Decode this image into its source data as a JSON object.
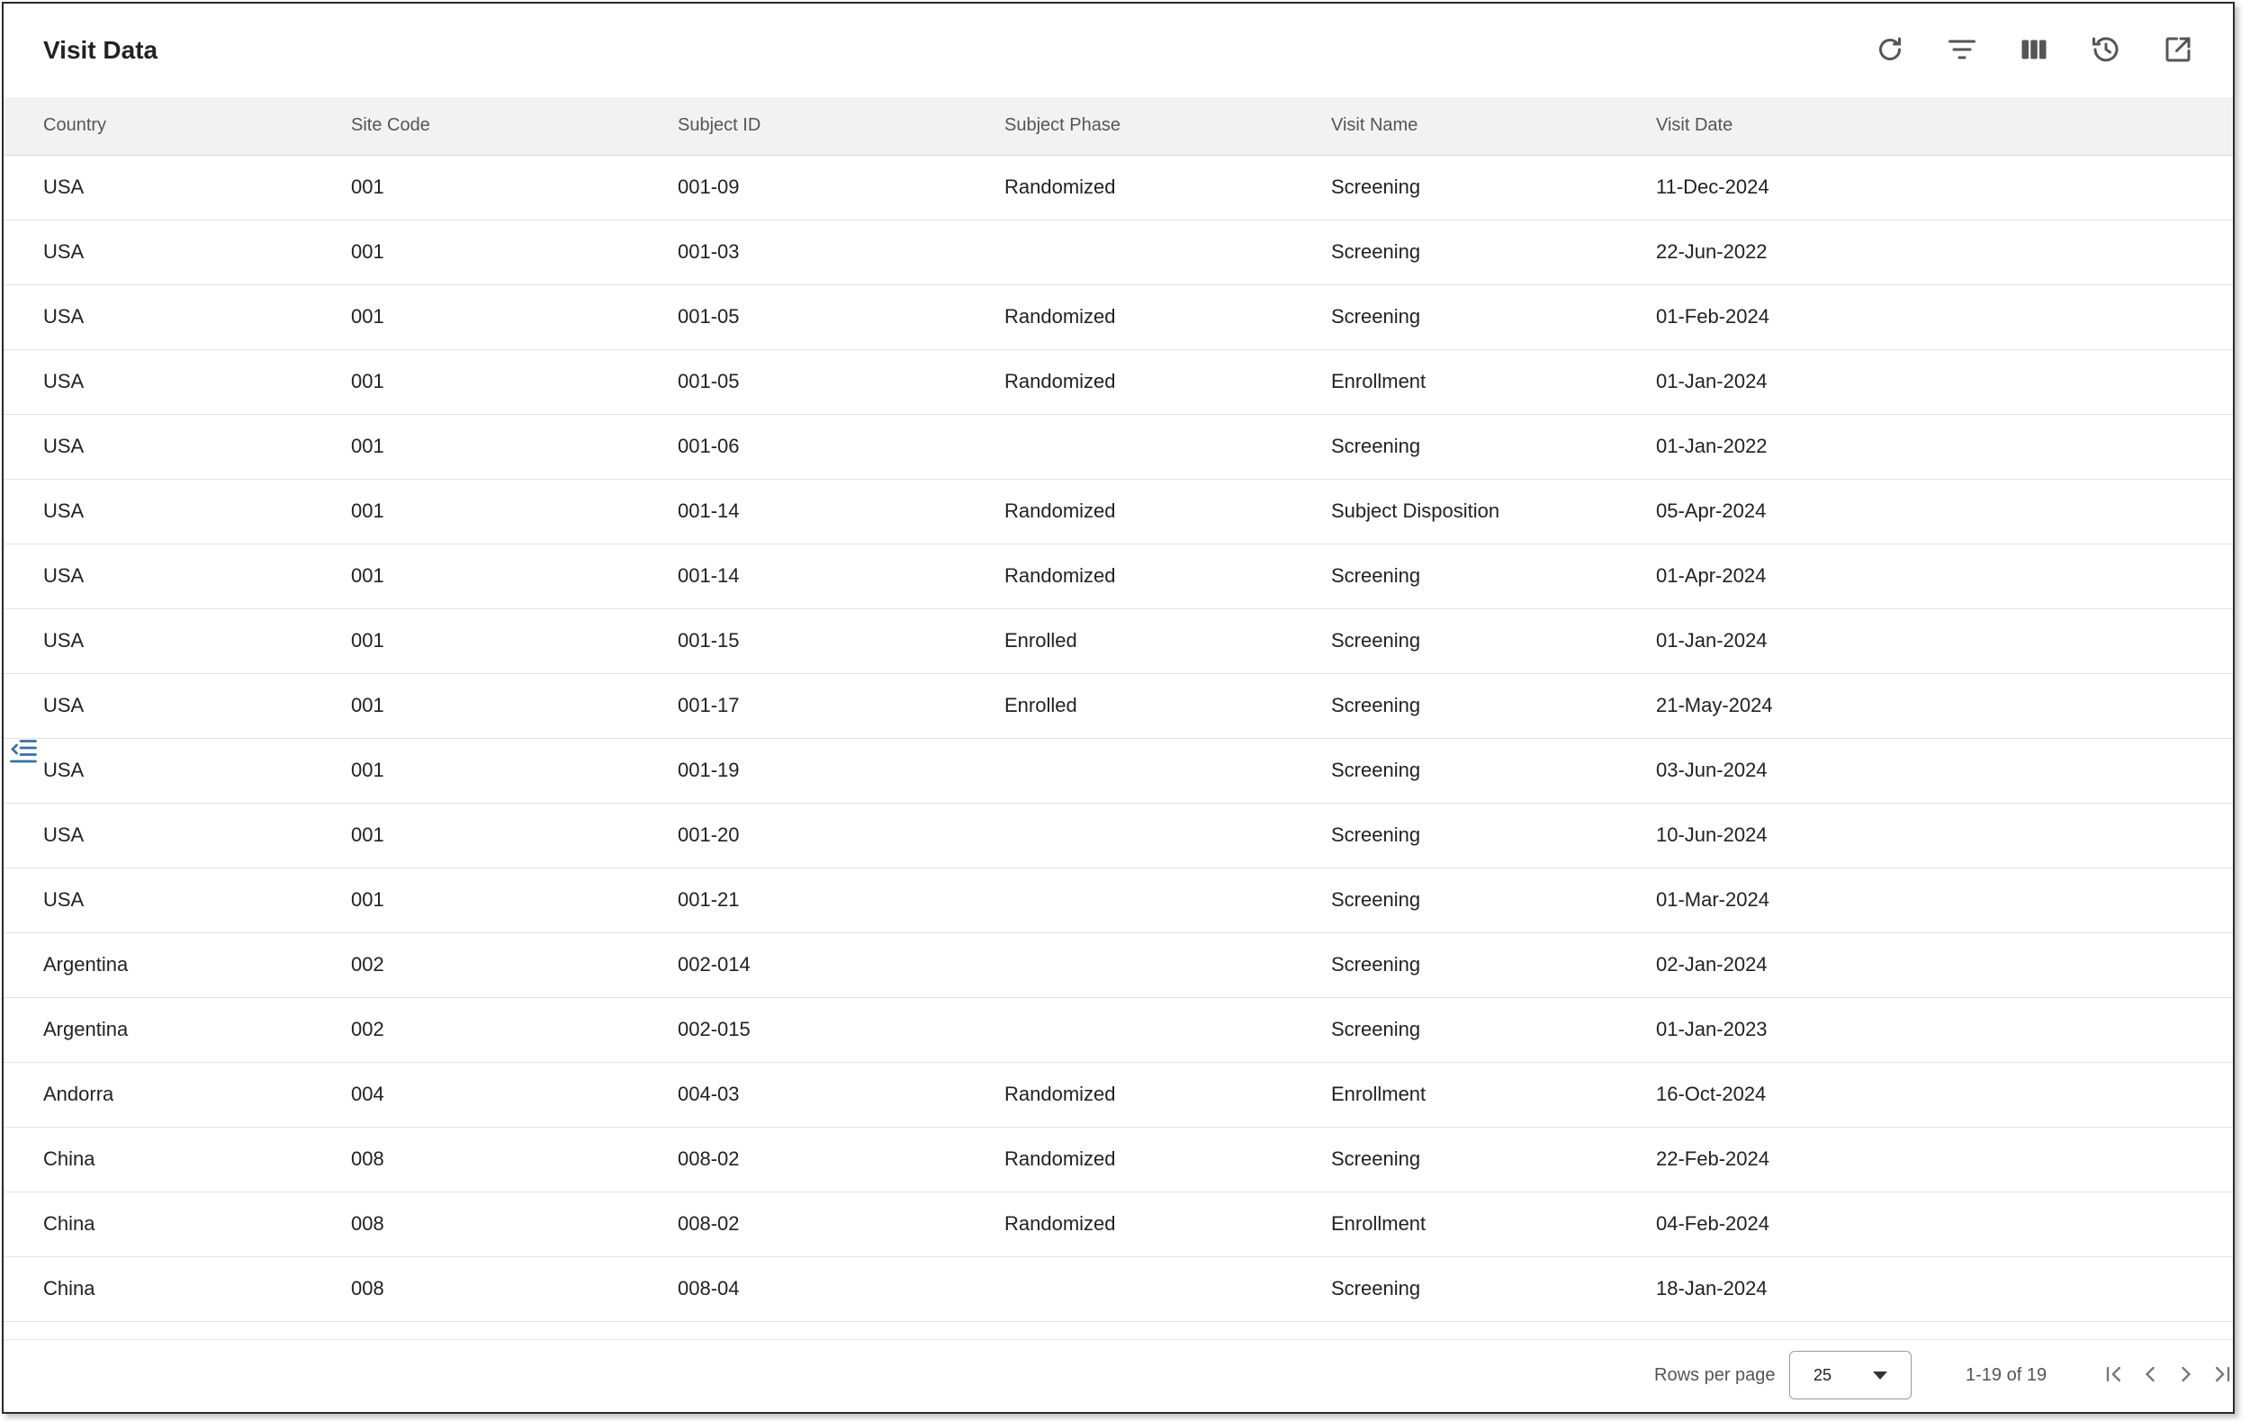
{
  "header": {
    "title": "Visit Data",
    "icons": [
      "refresh-icon",
      "filter-icon",
      "columns-icon",
      "history-icon",
      "open-external-icon"
    ]
  },
  "table": {
    "columns": [
      "Country",
      "Site Code",
      "Subject ID",
      "Subject Phase",
      "Visit Name",
      "Visit Date"
    ],
    "rows": [
      [
        "USA",
        "001",
        "001-09",
        "Randomized",
        "Screening",
        "11-Dec-2024"
      ],
      [
        "USA",
        "001",
        "001-03",
        "",
        "Screening",
        "22-Jun-2022"
      ],
      [
        "USA",
        "001",
        "001-05",
        "Randomized",
        "Screening",
        "01-Feb-2024"
      ],
      [
        "USA",
        "001",
        "001-05",
        "Randomized",
        "Enrollment",
        "01-Jan-2024"
      ],
      [
        "USA",
        "001",
        "001-06",
        "",
        "Screening",
        "01-Jan-2022"
      ],
      [
        "USA",
        "001",
        "001-14",
        "Randomized",
        "Subject Disposition",
        "05-Apr-2024"
      ],
      [
        "USA",
        "001",
        "001-14",
        "Randomized",
        "Screening",
        "01-Apr-2024"
      ],
      [
        "USA",
        "001",
        "001-15",
        "Enrolled",
        "Screening",
        "01-Jan-2024"
      ],
      [
        "USA",
        "001",
        "001-17",
        "Enrolled",
        "Screening",
        "21-May-2024"
      ],
      [
        "USA",
        "001",
        "001-19",
        "",
        "Screening",
        "03-Jun-2024"
      ],
      [
        "USA",
        "001",
        "001-20",
        "",
        "Screening",
        "10-Jun-2024"
      ],
      [
        "USA",
        "001",
        "001-21",
        "",
        "Screening",
        "01-Mar-2024"
      ],
      [
        "Argentina",
        "002",
        "002-014",
        "",
        "Screening",
        "02-Jan-2024"
      ],
      [
        "Argentina",
        "002",
        "002-015",
        "",
        "Screening",
        "01-Jan-2023"
      ],
      [
        "Andorra",
        "004",
        "004-03",
        "Randomized",
        "Enrollment",
        "16-Oct-2024"
      ],
      [
        "China",
        "008",
        "008-02",
        "Randomized",
        "Screening",
        "22-Feb-2024"
      ],
      [
        "China",
        "008",
        "008-02",
        "Randomized",
        "Enrollment",
        "04-Feb-2024"
      ],
      [
        "China",
        "008",
        "008-04",
        "",
        "Screening",
        "18-Jan-2024"
      ]
    ]
  },
  "footer": {
    "rows_per_page_label": "Rows per page",
    "rows_per_page_value": "25",
    "range_text": "1-19 of 19"
  },
  "colors": {
    "header_bg": "#f2f2f2",
    "icon": "#555555",
    "border": "#2b2b2b"
  }
}
